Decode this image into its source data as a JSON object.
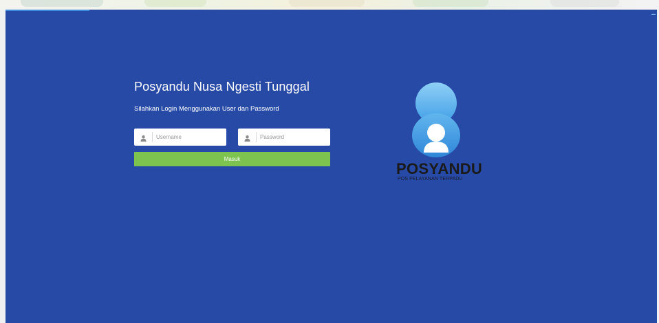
{
  "login": {
    "title": "Posyandu Nusa Ngesti Tunggal",
    "subtitle": "Silahkan Login Menggunakan User dan Password",
    "username_placeholder": "Username",
    "password_placeholder": "Password",
    "submit_label": "Masuk"
  },
  "logo": {
    "name": "POSYANDU",
    "tagline": "POS PELAYANAN TERPADU"
  },
  "icons": {
    "username": "user-icon",
    "password": "user-icon",
    "logo": "posyandu-person-icon"
  },
  "colors": {
    "background": "#264aa6",
    "button": "#7cc350",
    "logo_blue": "#4fa6e8",
    "logo_name": "#1a1a1a"
  }
}
